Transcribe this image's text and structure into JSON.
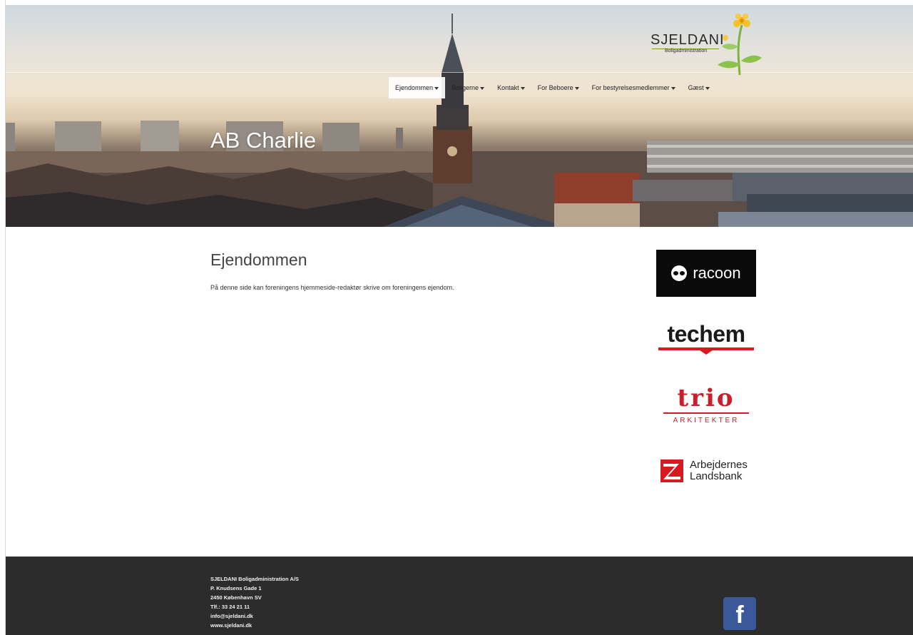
{
  "brand": {
    "name": "SJELDANI",
    "tagline": "Boligadministration"
  },
  "nav": {
    "items": [
      {
        "label": "Ejendommen",
        "active": true
      },
      {
        "label": "Boligerne",
        "active": false
      },
      {
        "label": "Kontakt",
        "active": false
      },
      {
        "label": "For Beboere",
        "active": false
      },
      {
        "label": "For bestyrelsesmedlemmer",
        "active": false
      },
      {
        "label": "Gæst",
        "active": false
      }
    ]
  },
  "hero": {
    "title": "AB Charlie"
  },
  "main": {
    "heading": "Ejendommen",
    "body": "På denne side kan foreningens hjemmeside-redaktør skrive om foreningens ejendom."
  },
  "sponsors": {
    "racoon": "racoon",
    "techem": "techem",
    "trio": {
      "word": "trio",
      "sub": "ARKITEKTER"
    },
    "alb": {
      "line1": "Arbejdernes",
      "line2": "Landsbank"
    }
  },
  "footer": {
    "company": "SJELDANI Boligadministration A/S",
    "street": "P. Knudsens Gade 1",
    "city": "2450 København SV",
    "phone": "Tlf.: 33 24 21 11",
    "email": "info@sjeldani.dk",
    "web": "www.sjeldani.dk",
    "facebook_icon": "facebook-icon"
  },
  "colors": {
    "footer_bg": "#2c2c2c",
    "facebook": "#3b5998",
    "trio_red": "#c8202a",
    "logo_green": "#6fa33a"
  }
}
